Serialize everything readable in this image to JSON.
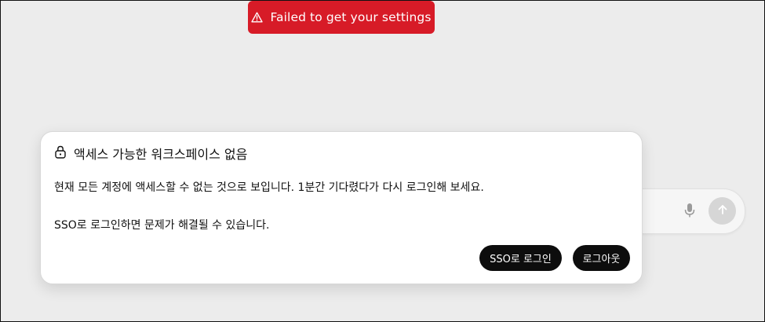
{
  "toast": {
    "message": "Failed to get your settings",
    "icon": "warning-triangle-icon",
    "color": "#d71b27"
  },
  "composer": {
    "mic_icon": "microphone-icon",
    "send_icon": "arrow-up-icon"
  },
  "dialog": {
    "title": "액세스 가능한 워크스페이스 없음",
    "title_icon": "lock-icon",
    "message_primary": "현재 모든 계정에 액세스할 수 없는 것으로 보입니다. 1분간 기다렸다가 다시 로그인해 보세요.",
    "message_secondary": "SSO로 로그인하면 문제가 해결될 수 있습니다.",
    "buttons": {
      "sso_login": "SSO로 로그인",
      "logout": "로그아웃"
    }
  }
}
